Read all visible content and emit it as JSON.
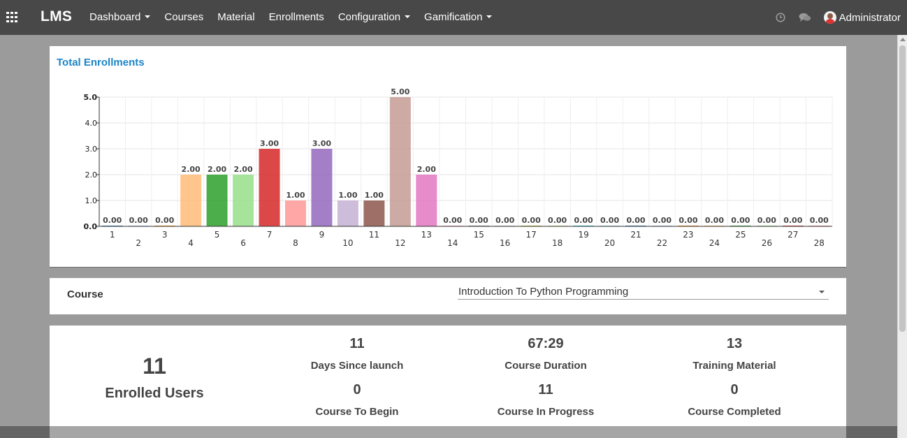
{
  "navbar": {
    "brand": "LMS",
    "menu": [
      {
        "label": "Dashboard",
        "dropdown": true
      },
      {
        "label": "Courses",
        "dropdown": false
      },
      {
        "label": "Material",
        "dropdown": false
      },
      {
        "label": "Enrollments",
        "dropdown": false
      },
      {
        "label": "Configuration",
        "dropdown": true
      },
      {
        "label": "Gamification",
        "dropdown": true
      }
    ],
    "icons": [
      "apps-grid-icon",
      "clock-icon",
      "chat-icon",
      "user-avatar-icon"
    ],
    "user": "Administrator"
  },
  "chart_panel": {
    "title": "Total Enrollments"
  },
  "chart_data": {
    "type": "bar",
    "title": "Total Enrollments",
    "categories": [
      "1",
      "2",
      "3",
      "4",
      "5",
      "6",
      "7",
      "8",
      "9",
      "10",
      "11",
      "12",
      "13",
      "14",
      "15",
      "16",
      "17",
      "18",
      "19",
      "20",
      "21",
      "22",
      "23",
      "24",
      "25",
      "26",
      "27",
      "28"
    ],
    "values": [
      0,
      0,
      0,
      2,
      2,
      2,
      3,
      1,
      3,
      1,
      1,
      5,
      2,
      0,
      0,
      0,
      0,
      0,
      0,
      0,
      0,
      0,
      0,
      0,
      0,
      0,
      0,
      0
    ],
    "data_labels": [
      "0.00",
      "0.00",
      "0.00",
      "2.00",
      "2.00",
      "2.00",
      "3.00",
      "1.00",
      "3.00",
      "1.00",
      "1.00",
      "5.00",
      "2.00",
      "0.00",
      "0.00",
      "0.00",
      "0.00",
      "0.00",
      "0.00",
      "0.00",
      "0.00",
      "0.00",
      "0.00",
      "0.00",
      "0.00",
      "0.00",
      "0.00",
      "0.00"
    ],
    "colors": [
      "#1f77b4",
      "#aec7e8",
      "#ff7f0e",
      "#ffbb78",
      "#2ca02c",
      "#98df8a",
      "#d62728",
      "#ff9896",
      "#9467bd",
      "#c5b0d5",
      "#8c564b",
      "#c49c94",
      "#e377c2",
      "#f7b6d2",
      "#7f7f7f",
      "#c7c7c7",
      "#bcbd22",
      "#dbdb8d",
      "#17becf",
      "#9edae5",
      "#1f77b4",
      "#aec7e8",
      "#ff7f0e",
      "#ffbb78",
      "#2ca02c",
      "#98df8a",
      "#d62728",
      "#ff9896"
    ],
    "yticks": [
      "0.0",
      "1.0",
      "2.0",
      "3.0",
      "4.0",
      "5.0"
    ],
    "ylim": [
      0,
      5
    ],
    "grid": true,
    "legend": "none"
  },
  "course_filter": {
    "label": "Course",
    "selected": "Introduction To Python Programming"
  },
  "stats": {
    "enrolled_users": {
      "value": "11",
      "label": "Enrolled Users"
    },
    "items": [
      {
        "value": "11",
        "label": "Days Since launch"
      },
      {
        "value": "67:29",
        "label": "Course Duration"
      },
      {
        "value": "13",
        "label": "Training Material"
      },
      {
        "value": "0",
        "label": "Course To Begin"
      },
      {
        "value": "11",
        "label": "Course In Progress"
      },
      {
        "value": "0",
        "label": "Course Completed"
      }
    ]
  }
}
